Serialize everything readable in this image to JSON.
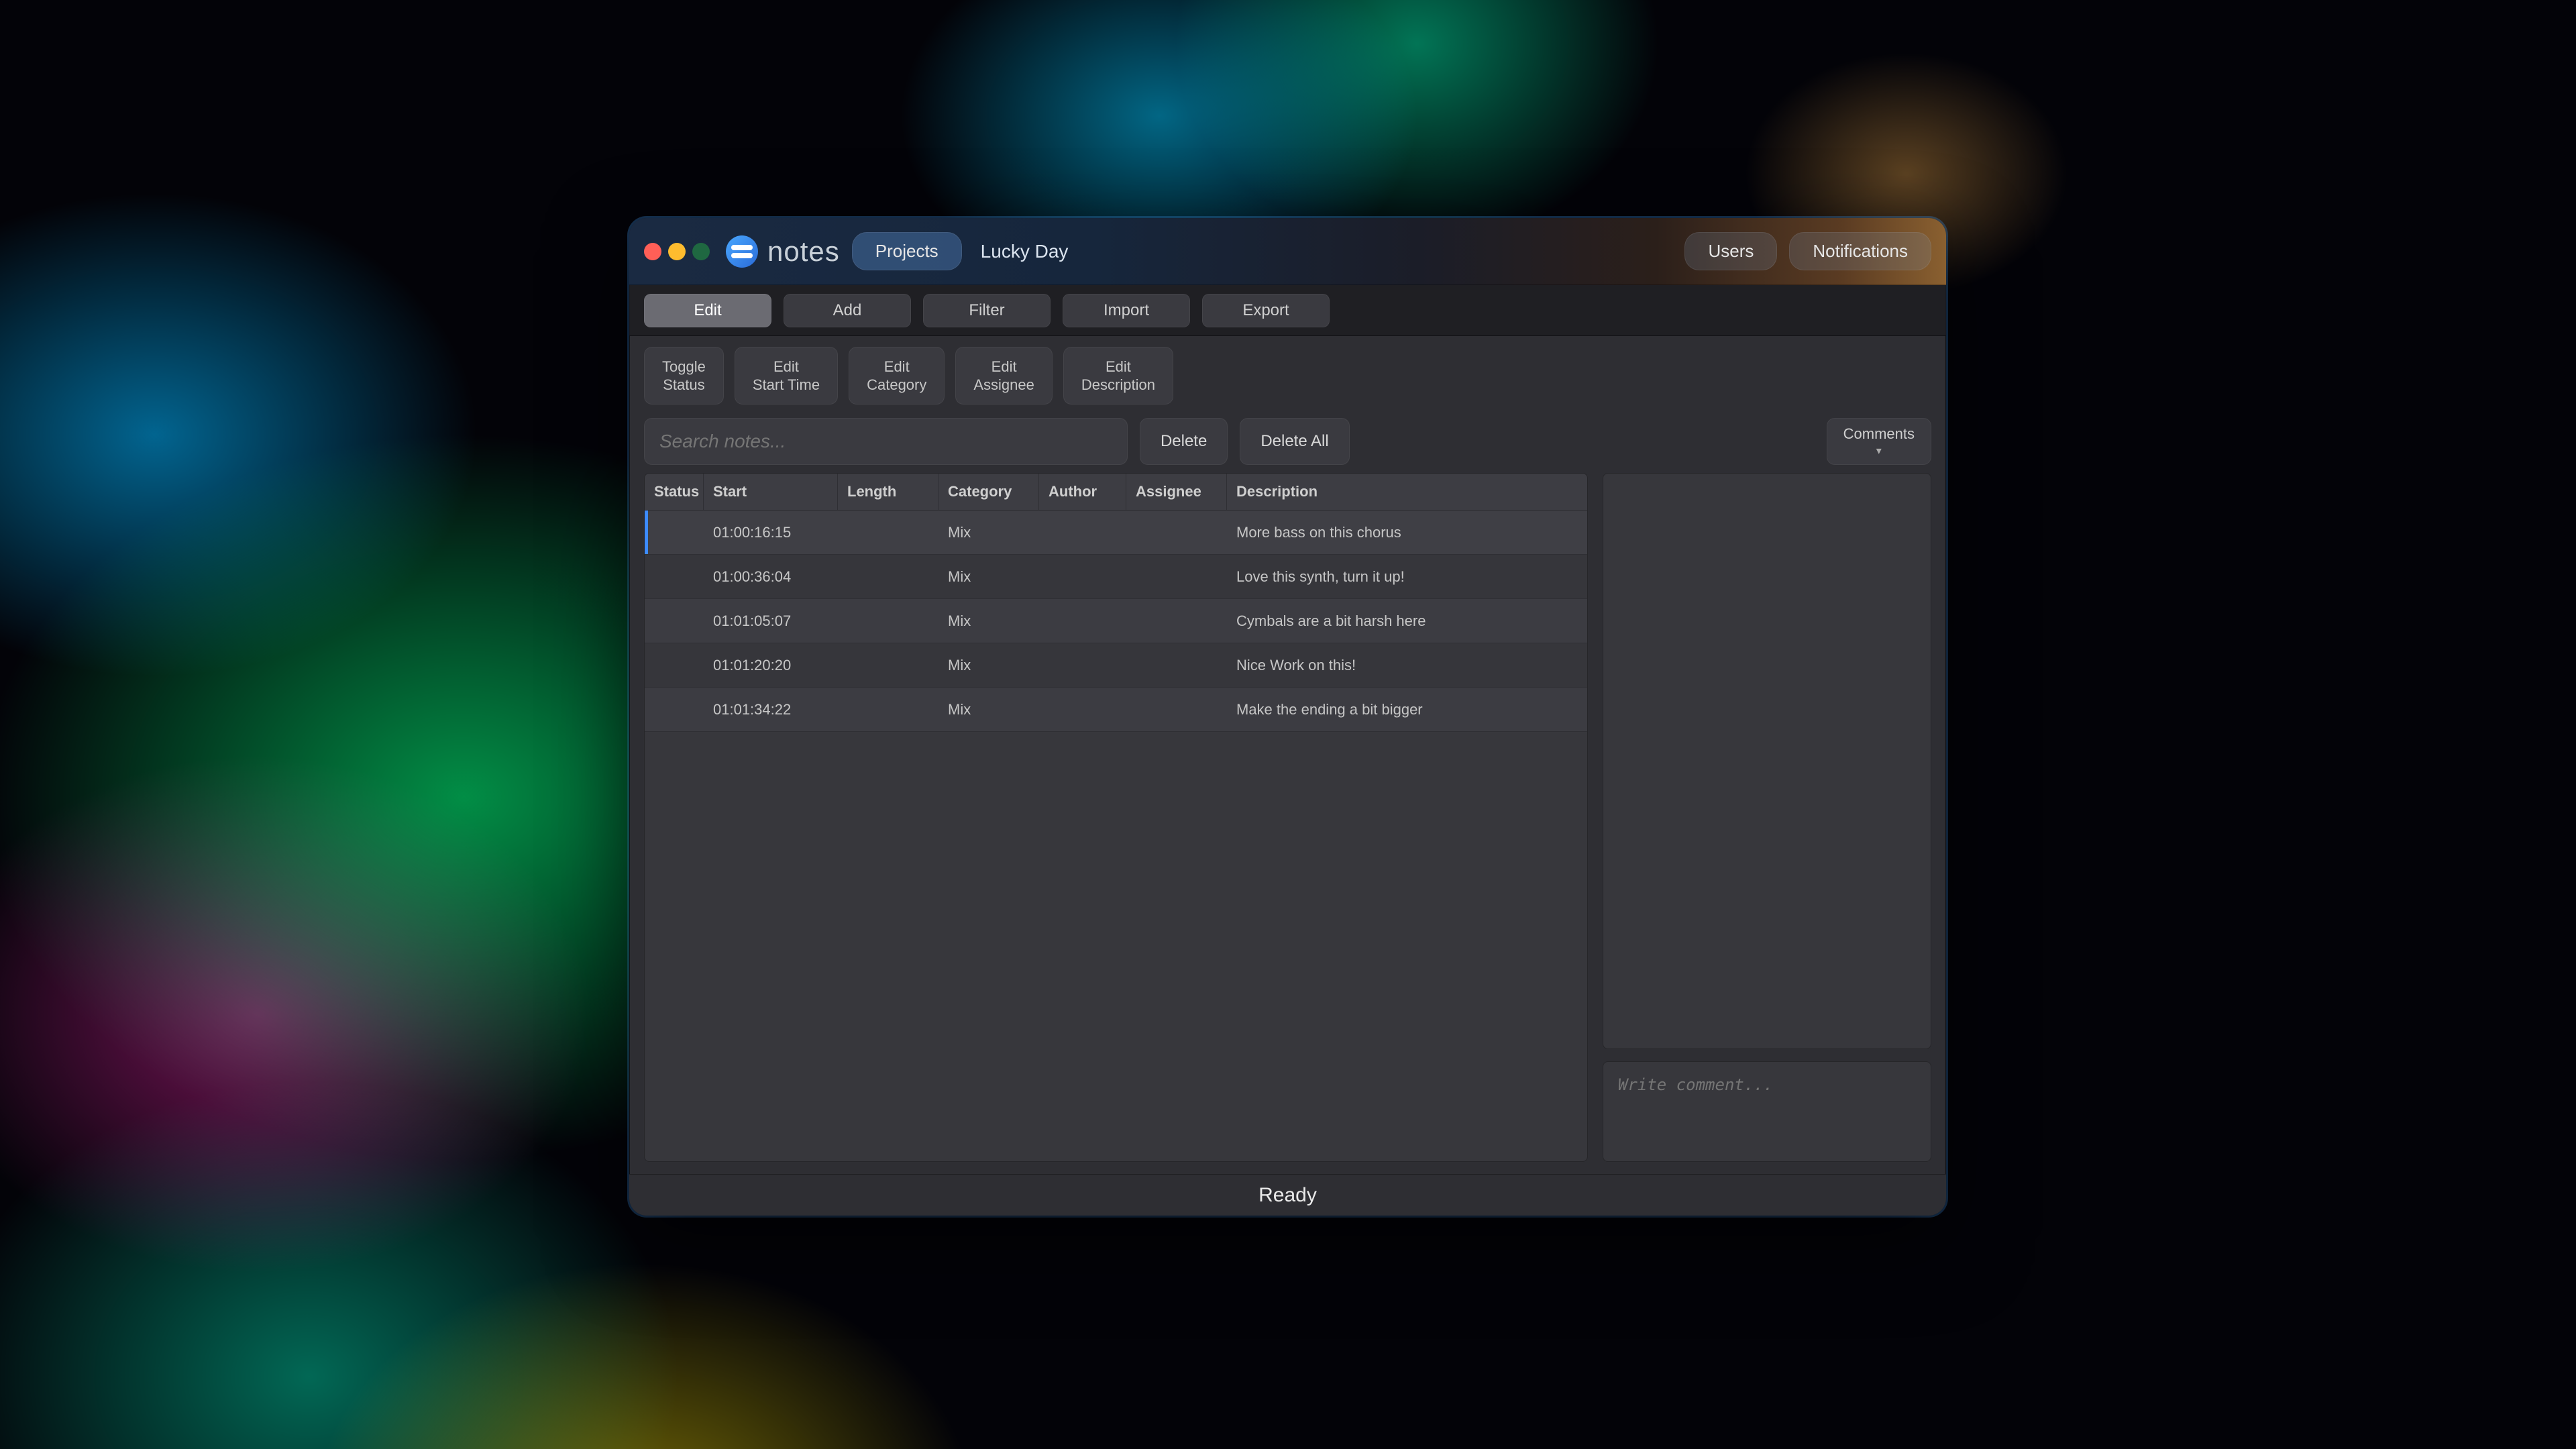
{
  "app": {
    "name": "notes"
  },
  "header": {
    "projects_label": "Projects",
    "project_name": "Lucky Day",
    "users_label": "Users",
    "notifications_label": "Notifications"
  },
  "toolbar": {
    "edit": "Edit",
    "add": "Add",
    "filter": "Filter",
    "import": "Import",
    "export": "Export",
    "active": "edit"
  },
  "subtoolbar": {
    "toggle_status": "Toggle\nStatus",
    "edit_start": "Edit\nStart Time",
    "edit_category": "Edit\nCategory",
    "edit_assignee": "Edit\nAssignee",
    "edit_description": "Edit\nDescription"
  },
  "search": {
    "placeholder": "Search notes...",
    "value": ""
  },
  "actions": {
    "delete": "Delete",
    "delete_all": "Delete All",
    "comments": "Comments"
  },
  "table": {
    "columns": {
      "status": "Status",
      "start": "Start",
      "length": "Length",
      "category": "Category",
      "author": "Author",
      "assignee": "Assignee",
      "description": "Description"
    },
    "rows": [
      {
        "start": "01:00:16:15",
        "category": "Mix",
        "description": "More bass on this chorus",
        "selected": true
      },
      {
        "start": "01:00:36:04",
        "category": "Mix",
        "description": "Love this synth, turn it up!"
      },
      {
        "start": "01:01:05:07",
        "category": "Mix",
        "description": "Cymbals are a bit harsh here"
      },
      {
        "start": "01:01:20:20",
        "category": "Mix",
        "description": "Nice Work on this!"
      },
      {
        "start": "01:01:34:22",
        "category": "Mix",
        "description": "Make the ending a bit bigger"
      }
    ]
  },
  "comment_input": {
    "placeholder": "Write comment..."
  },
  "status": "Ready"
}
